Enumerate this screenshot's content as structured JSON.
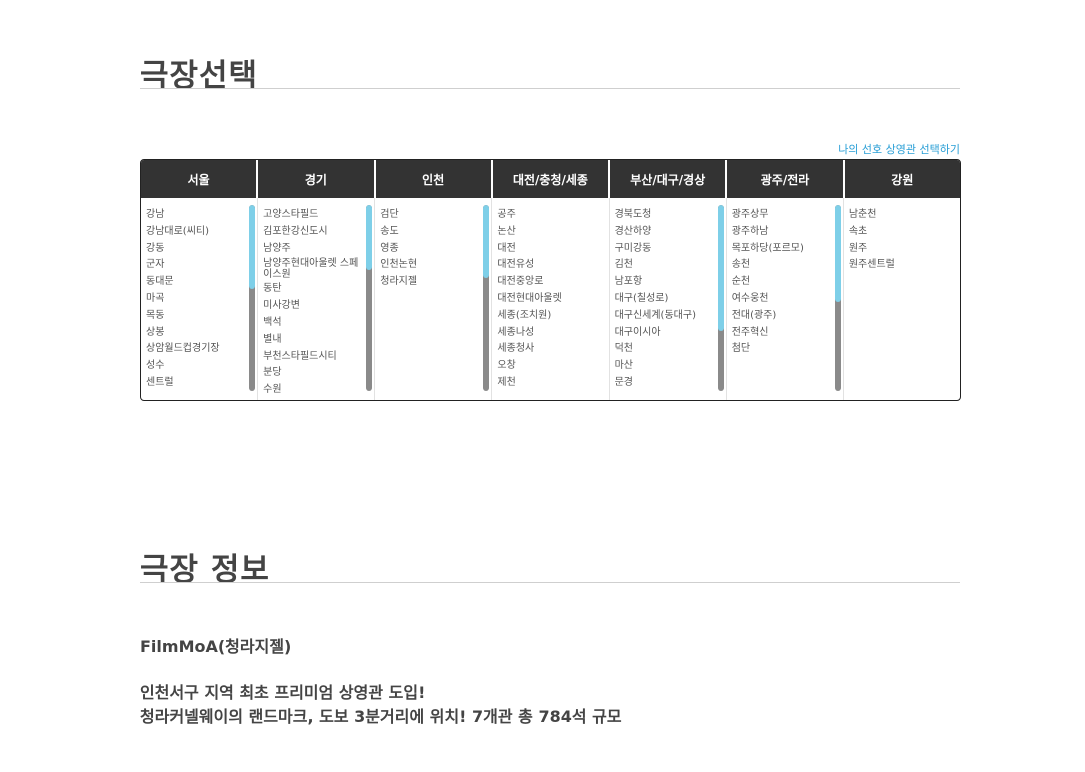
{
  "theater_select": {
    "title": "극장선택",
    "favorite_link": "나의 선호 상영관 선택하기",
    "regions": [
      {
        "name": "서울",
        "theaters": [
          "강남",
          "강남대로(씨티)",
          "강동",
          "군자",
          "동대문",
          "마곡",
          "목동",
          "상봉",
          "상암월드컵경기장",
          "성수",
          "센트럴"
        ],
        "scroll_fraction": 0.45
      },
      {
        "name": "경기",
        "theaters": [
          "고양스타필드",
          "김포한강신도시",
          "남양주",
          "남양주현대아울렛 스페이스원",
          "동탄",
          "미사강변",
          "백석",
          "별내",
          "부천스타필드시티",
          "분당",
          "수원"
        ],
        "scroll_fraction": 0.35
      },
      {
        "name": "인천",
        "theaters": [
          "검단",
          "송도",
          "영종",
          "인천논현",
          "청라지젤"
        ],
        "scroll_fraction": 0.39
      },
      {
        "name": "대전/충청/세종",
        "theaters": [
          "공주",
          "논산",
          "대전",
          "대전유성",
          "대전중앙로",
          "대전현대아울렛",
          "세종(조치원)",
          "세종나성",
          "세종청사",
          "오창",
          "제천"
        ],
        "scroll_fraction": null
      },
      {
        "name": "부산/대구/경상",
        "theaters": [
          "경북도청",
          "경산하양",
          "구미강동",
          "김천",
          "남포항",
          "대구(칠성로)",
          "대구신세계(동대구)",
          "대구이시아",
          "덕천",
          "마산",
          "문경"
        ],
        "scroll_fraction": 0.68
      },
      {
        "name": "광주/전라",
        "theaters": [
          "광주상무",
          "광주하남",
          "목포하당(포르모)",
          "송천",
          "순천",
          "여수웅천",
          "전대(광주)",
          "전주혁신",
          "첨단"
        ],
        "scroll_fraction": 0.52
      },
      {
        "name": "강원",
        "theaters": [
          "남춘천",
          "속초",
          "원주",
          "원주센트럴"
        ],
        "scroll_fraction": null
      }
    ]
  },
  "theater_info": {
    "title": "극장 정보",
    "name": "FilmMoA(청라지젤)",
    "description_line1": "인천서구 지역 최초 프리미엄 상영관 도입!",
    "description_line2": "청라커넬웨이의 랜드마크, 도보 3분거리에 위치! 7개관 총 784석 규모"
  },
  "colors": {
    "tab_background": "#333333",
    "scroll_thumb": "#7ecfe8",
    "scroll_track": "#8a8a8a",
    "link": "#2a9fd6"
  }
}
